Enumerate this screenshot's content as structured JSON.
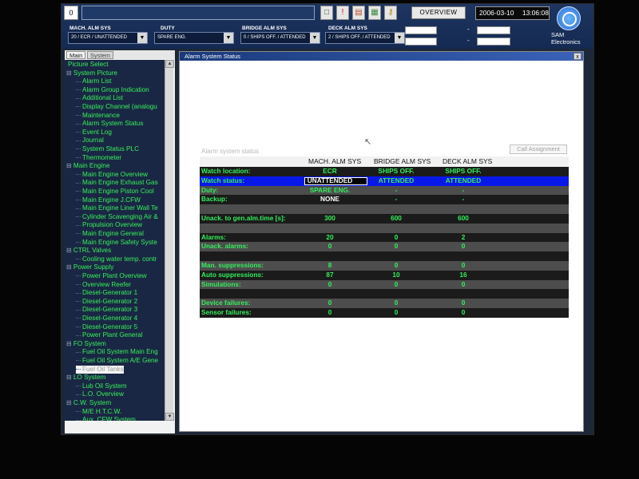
{
  "topbar": {
    "count": "0",
    "overview_label": "OVERVIEW",
    "date": "2006-03-10",
    "time": "13:06:08",
    "brand_line1": "SAM",
    "brand_line2": "Electronics",
    "mach_label": "MACH. ALM SYS",
    "mach_value": "20 / ECR / UNATTENDED",
    "duty_label": "DUTY",
    "duty_value": "SPARE ENG.",
    "bridge_label": "BRIDGE ALM SYS",
    "bridge_value": "0 / SHIPS OFF. / ATTENDED",
    "deck_label": "DECK ALM SYS",
    "deck_value": "2 / SHIPS OFF. / ATTENDED",
    "dash": "-"
  },
  "sidebar": {
    "tab_main": "Main",
    "tab_system": "System",
    "tree": [
      {
        "label": "Picture Select",
        "level": 0,
        "expander": ""
      },
      {
        "label": "System Picture",
        "level": 0,
        "expander": "⊟"
      },
      {
        "label": "Alarm List",
        "level": 1,
        "expander": ""
      },
      {
        "label": "Alarm Group Indication",
        "level": 1,
        "expander": ""
      },
      {
        "label": "Additional List",
        "level": 1,
        "expander": ""
      },
      {
        "label": "Display Channel (analogu",
        "level": 1,
        "expander": ""
      },
      {
        "label": "Maintenance",
        "level": 1,
        "expander": ""
      },
      {
        "label": "Alarm System Status",
        "level": 1,
        "expander": ""
      },
      {
        "label": "Event Log",
        "level": 1,
        "expander": ""
      },
      {
        "label": "Journal",
        "level": 1,
        "expander": ""
      },
      {
        "label": "System Status PLC",
        "level": 1,
        "expander": ""
      },
      {
        "label": "Thermometer",
        "level": 1,
        "expander": ""
      },
      {
        "label": "Main Engine",
        "level": 0,
        "expander": "⊟"
      },
      {
        "label": "Main Engine Overview",
        "level": 1,
        "expander": ""
      },
      {
        "label": "Main Engine Exhaust Gas",
        "level": 1,
        "expander": ""
      },
      {
        "label": "Main Engine Piston Cool",
        "level": 1,
        "expander": ""
      },
      {
        "label": "Main Engine J.CFW",
        "level": 1,
        "expander": ""
      },
      {
        "label": "Main Engine Liner Wall Te",
        "level": 1,
        "expander": ""
      },
      {
        "label": "Cylinder Scavenging Air &",
        "level": 1,
        "expander": ""
      },
      {
        "label": "Propulsion Overview",
        "level": 1,
        "expander": ""
      },
      {
        "label": "Main Engine General",
        "level": 1,
        "expander": ""
      },
      {
        "label": "Main Engine Safety Syste",
        "level": 1,
        "expander": ""
      },
      {
        "label": "CTRL Valves",
        "level": 0,
        "expander": "⊟"
      },
      {
        "label": "Cooling water temp. contr",
        "level": 1,
        "expander": ""
      },
      {
        "label": "Power Supply",
        "level": 0,
        "expander": "⊟"
      },
      {
        "label": "Power Plant Overview",
        "level": 1,
        "expander": ""
      },
      {
        "label": "Overview Reefer",
        "level": 1,
        "expander": ""
      },
      {
        "label": "Diesel-Generator 1",
        "level": 1,
        "expander": ""
      },
      {
        "label": "Diesel-Generator 2",
        "level": 1,
        "expander": ""
      },
      {
        "label": "Diesel-Generator 3",
        "level": 1,
        "expander": ""
      },
      {
        "label": "Diesel-Generator 4",
        "level": 1,
        "expander": ""
      },
      {
        "label": "Diesel-Generator 5",
        "level": 1,
        "expander": ""
      },
      {
        "label": "Power Plant General",
        "level": 1,
        "expander": ""
      },
      {
        "label": "FO System",
        "level": 0,
        "expander": "⊟"
      },
      {
        "label": "Fuel Oil System Main Eng",
        "level": 1,
        "expander": ""
      },
      {
        "label": "Fuel Oil System A/E Gene",
        "level": 1,
        "expander": ""
      },
      {
        "label": "Fuel Oil Tanks",
        "level": 1,
        "expander": "",
        "highlight": true
      },
      {
        "label": "LO System",
        "level": 0,
        "expander": "⊟"
      },
      {
        "label": "Lub Oil System",
        "level": 1,
        "expander": ""
      },
      {
        "label": "L.O. Overview",
        "level": 1,
        "expander": ""
      },
      {
        "label": "C.W. System",
        "level": 0,
        "expander": "⊟"
      },
      {
        "label": "M/E H.T.C.W.",
        "level": 1,
        "expander": ""
      },
      {
        "label": "Aux. CFW System",
        "level": 1,
        "expander": ""
      }
    ]
  },
  "window": {
    "title": "Alarm System Status",
    "close_glyph": "x",
    "panel_title": "Alarm system status",
    "contact_button": "Call Assignment",
    "columns": [
      "MACH. ALM SYS",
      "BRIDGE ALM SYS",
      "DECK ALM SYS"
    ],
    "rows": [
      {
        "label": "Watch location:",
        "values": [
          "ECR",
          "SHIPS OFF.",
          "SHIPS OFF."
        ],
        "style": "dk"
      },
      {
        "label": "Watch status:",
        "values": [
          "UNATTENDED",
          "ATTENDED",
          "ATTENDED"
        ],
        "style": "sel"
      },
      {
        "label": "Duty:",
        "values": [
          "SPARE ENG.",
          "-",
          "-"
        ],
        "style": "md"
      },
      {
        "label": "Backup:",
        "values": [
          "NONE",
          "-",
          "-"
        ],
        "style": "dk"
      },
      {
        "label": "",
        "values": [
          "",
          "",
          ""
        ],
        "style": "md"
      },
      {
        "label": "Unack. to gen.alm.time [s]:",
        "values": [
          "300",
          "600",
          "600"
        ],
        "style": "dk"
      },
      {
        "label": "",
        "values": [
          "",
          "",
          ""
        ],
        "style": "md"
      },
      {
        "label": "Alarms:",
        "values": [
          "20",
          "0",
          "2"
        ],
        "style": "dk"
      },
      {
        "label": "Unack. alarms:",
        "values": [
          "0",
          "0",
          "0"
        ],
        "style": "md"
      },
      {
        "label": "",
        "values": [
          "",
          "",
          ""
        ],
        "style": "dk"
      },
      {
        "label": "Man. suppressions:",
        "values": [
          "8",
          "0",
          "0"
        ],
        "style": "md"
      },
      {
        "label": "Auto suppressions:",
        "values": [
          "87",
          "10",
          "16"
        ],
        "style": "dk"
      },
      {
        "label": "Simulations:",
        "values": [
          "0",
          "0",
          "0"
        ],
        "style": "md"
      },
      {
        "label": "",
        "values": [
          "",
          "",
          ""
        ],
        "style": "dk"
      },
      {
        "label": "Device failures:",
        "values": [
          "0",
          "0",
          "0"
        ],
        "style": "md"
      },
      {
        "label": "Sensor failures:",
        "values": [
          "0",
          "0",
          "0"
        ],
        "style": "dk"
      }
    ]
  },
  "colors": {
    "green_text": "#34ee5c",
    "selection_blue": "#0818e8",
    "title_bar": "#1a3a7a"
  }
}
